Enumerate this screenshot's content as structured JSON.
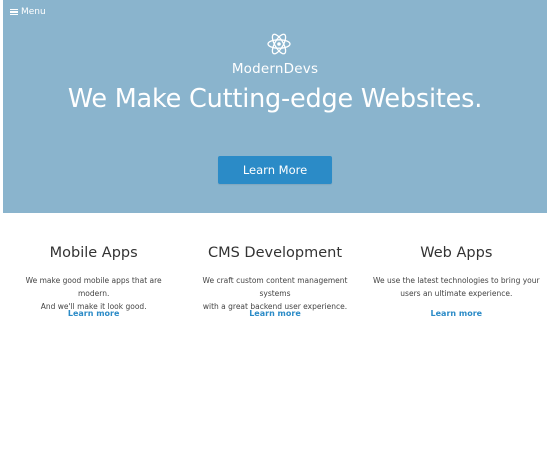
{
  "nav": {
    "menu_label": "Menu"
  },
  "hero": {
    "brand": "ModernDevs",
    "headline": "We Make Cutting-edge Websites.",
    "cta_label": "Learn More",
    "background_color": "#8ab4cd",
    "cta_color": "#2b8bc7",
    "logo_icon": "atom-icon"
  },
  "features": [
    {
      "title": "Mobile Apps",
      "line1": "We make good mobile apps that are modern.",
      "line2": "And we'll make it look good.",
      "link_label": "Learn more"
    },
    {
      "title": "CMS Development",
      "line1": "We craft custom content management systems",
      "line2": "with a great backend user experience.",
      "link_label": "Learn more"
    },
    {
      "title": "Web Apps",
      "line1": "We use the latest technologies to bring your",
      "line2": "users an ultimate experience.",
      "link_label": "Learn more"
    }
  ],
  "link_color": "#2b8bc7"
}
